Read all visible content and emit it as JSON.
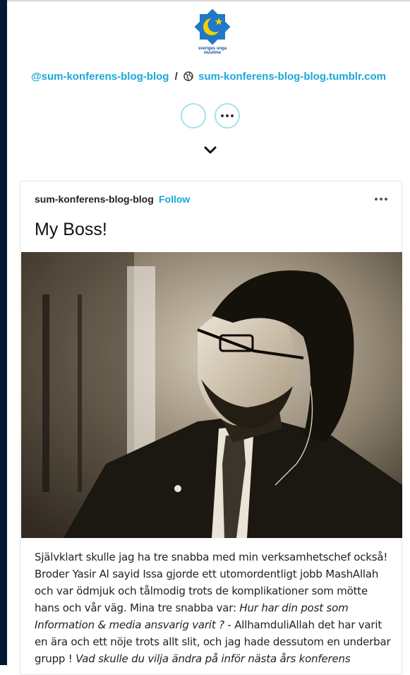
{
  "logo": {
    "text": "sveriges unga muslime",
    "icon": "star-crescent-icon",
    "colors": {
      "star": "#1f78c8",
      "crescent": "#f5d000"
    }
  },
  "header": {
    "blog_name_link": "@sum-konferens-blog-blog",
    "separator": "/",
    "url_icon": "globe-icon",
    "url_link": "sum-konferens-blog-blog.tumblr.com"
  },
  "actions": {
    "more_icon": "more-dots-icon",
    "expand_icon": "chevron-down-icon"
  },
  "post": {
    "author": "sum-konferens-blog-blog",
    "follow_label": "Follow",
    "menu_icon": "more-dots-icon",
    "title": "My Boss!",
    "body": {
      "p1": "Självklart skulle jag ha tre snabba med min verksamhetschef också! Broder Yasir Al sayid Issa gjorde ett utomordentligt jobb MashAllah och var ödmjuk och tålmodig trots de komplikationer som mötte hans och vår väg.   Mina tre snabba var: ",
      "q1": "Hur har din post som Information & media ansvarig varit ?",
      "a1": "  - AllhamduliAllah det har varit en ära och ett nöje trots allt slit, och jag hade dessutom en underbar grupp !  ",
      "q2": "Vad skulle du vilja ändra på inför nästa års konferens"
    }
  },
  "colors": {
    "accent": "#1aa9d8",
    "sidebar": "#001935"
  }
}
